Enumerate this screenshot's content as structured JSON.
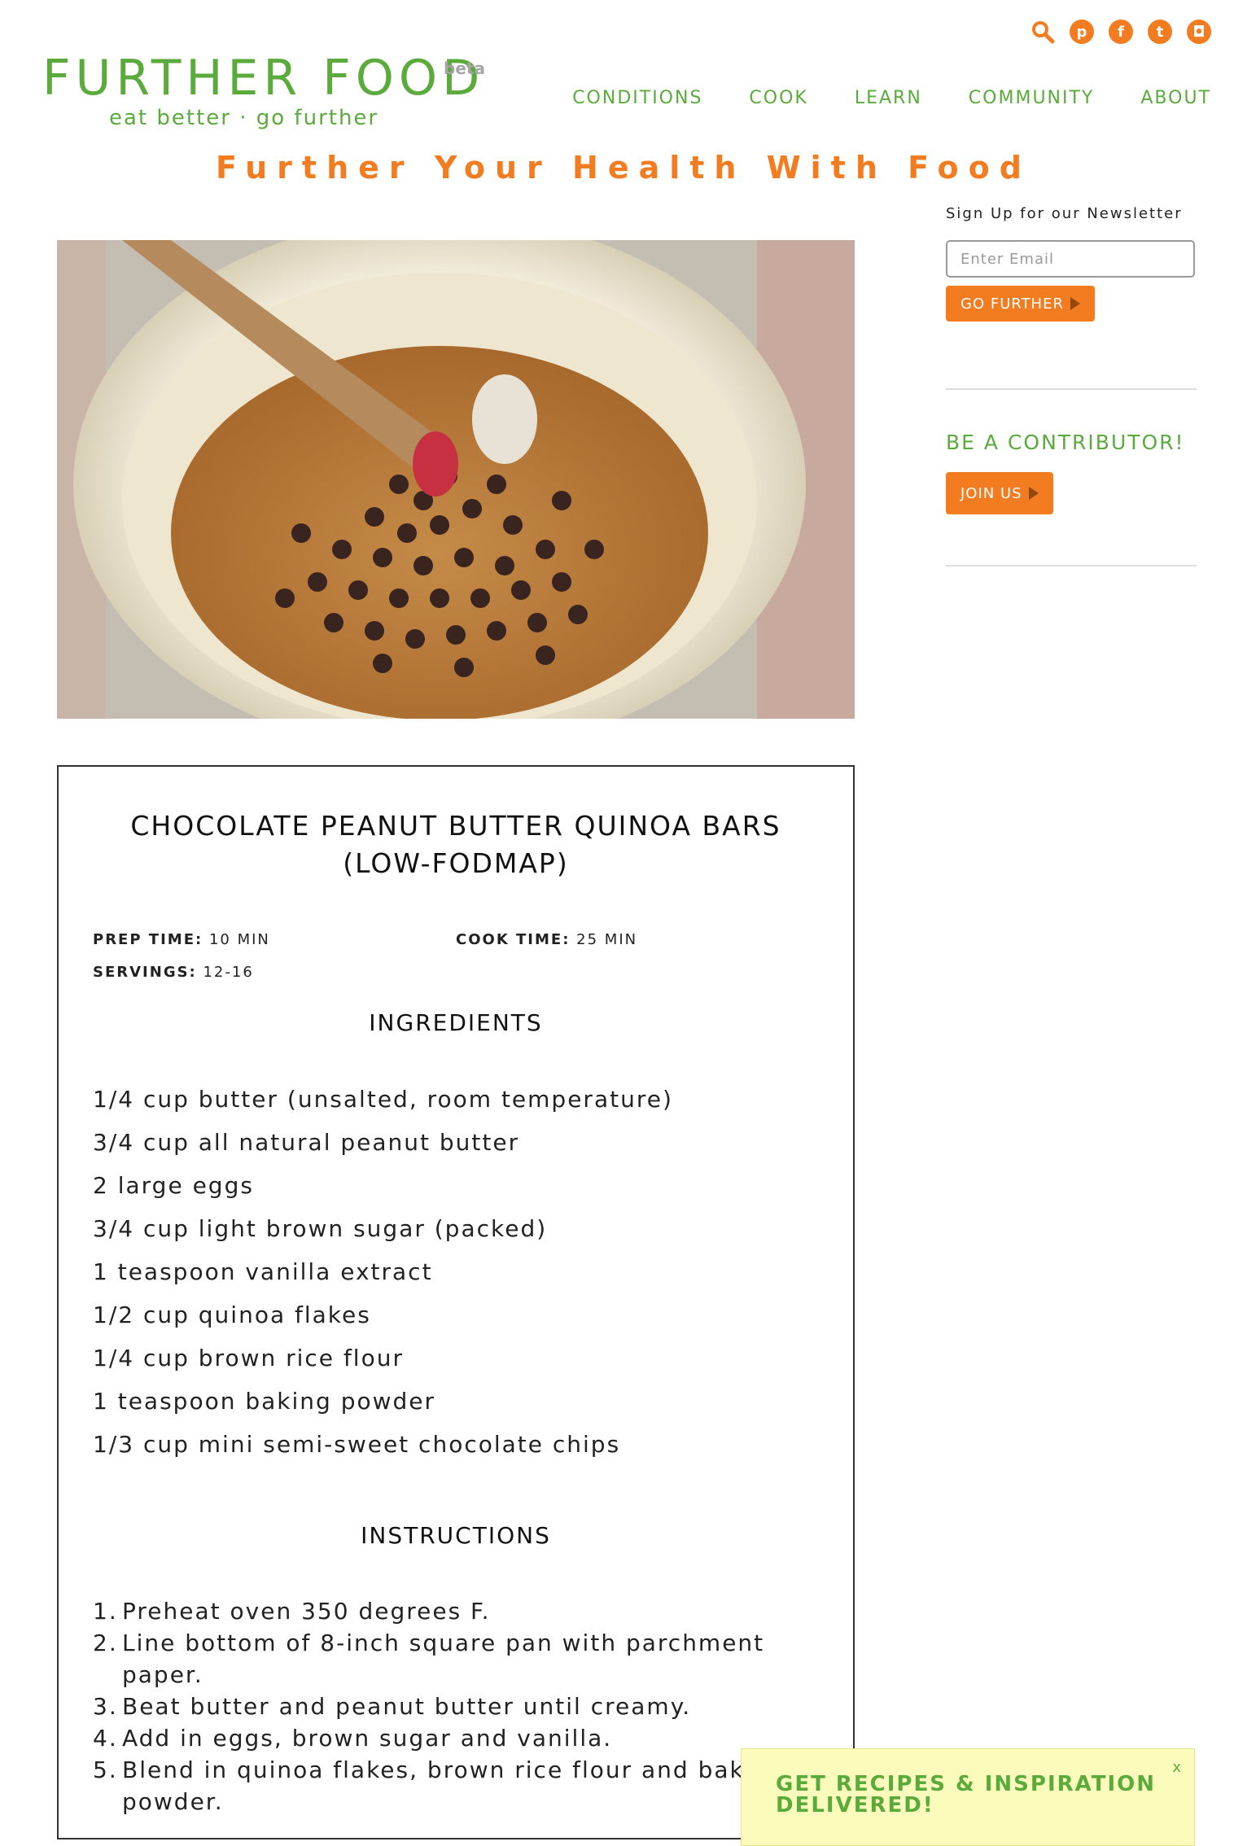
{
  "header": {
    "social": [
      {
        "icon": "search-icon"
      },
      {
        "icon": "pinterest-icon",
        "glyph": "p"
      },
      {
        "icon": "facebook-icon",
        "glyph": "f"
      },
      {
        "icon": "twitter-icon",
        "glyph": "t"
      },
      {
        "icon": "instagram-icon",
        "glyph": "◘"
      }
    ],
    "logo_text": "FURTHER FOOD",
    "logo_beta": "beta",
    "logo_tagline": "eat better · go further",
    "nav": [
      "CONDITIONS",
      "COOK",
      "LEARN",
      "COMMUNITY",
      "ABOUT"
    ],
    "tagline": "Further Your Health With Food"
  },
  "sidebar": {
    "newsletter_label": "Sign Up for our Newsletter",
    "email_placeholder": "Enter Email",
    "go_button": "GO FURTHER",
    "contributor_heading": "BE A CONTRIBUTOR!",
    "join_button": "JOIN US"
  },
  "recipe": {
    "title_line1": "CHOCOLATE PEANUT BUTTER QUINOA BARS",
    "title_line2": "(LOW-FODMAP)",
    "prep_label": "PREP TIME:",
    "prep_value": "10 MIN",
    "cook_label": "COOK TIME:",
    "cook_value": "25 MIN",
    "servings_label": "SERVINGS:",
    "servings_value": "12-16",
    "ingredients_heading": "INGREDIENTS",
    "ingredients": [
      "1/4 cup butter (unsalted, room temperature)",
      "3/4 cup all natural peanut butter",
      "2 large eggs",
      "3/4 cup light brown sugar (packed)",
      "1 teaspoon vanilla extract",
      "1/2 cup quinoa flakes",
      "1/4 cup brown rice flour",
      "1 teaspoon baking powder",
      "1/3 cup mini semi-sweet chocolate chips"
    ],
    "instructions_heading": "INSTRUCTIONS",
    "instructions": [
      {
        "num": "1.",
        "text": "Preheat oven 350 degrees F."
      },
      {
        "num": "2.",
        "text": "Line bottom of 8-inch square pan with parchment paper."
      },
      {
        "num": "3.",
        "text": "Beat butter and peanut butter until creamy."
      },
      {
        "num": "4.",
        "text": "Add in eggs, brown sugar and vanilla."
      },
      {
        "num": "5.",
        "text": "Blend in quinoa flakes, brown rice flour and baking powder."
      }
    ]
  },
  "popup": {
    "text": "GET RECIPES & INSPIRATION DELIVERED!",
    "close": "x"
  },
  "colors": {
    "brand_green": "#5aaa3c",
    "brand_orange": "#f47c20",
    "popup_bg": "#fbfcbb"
  }
}
